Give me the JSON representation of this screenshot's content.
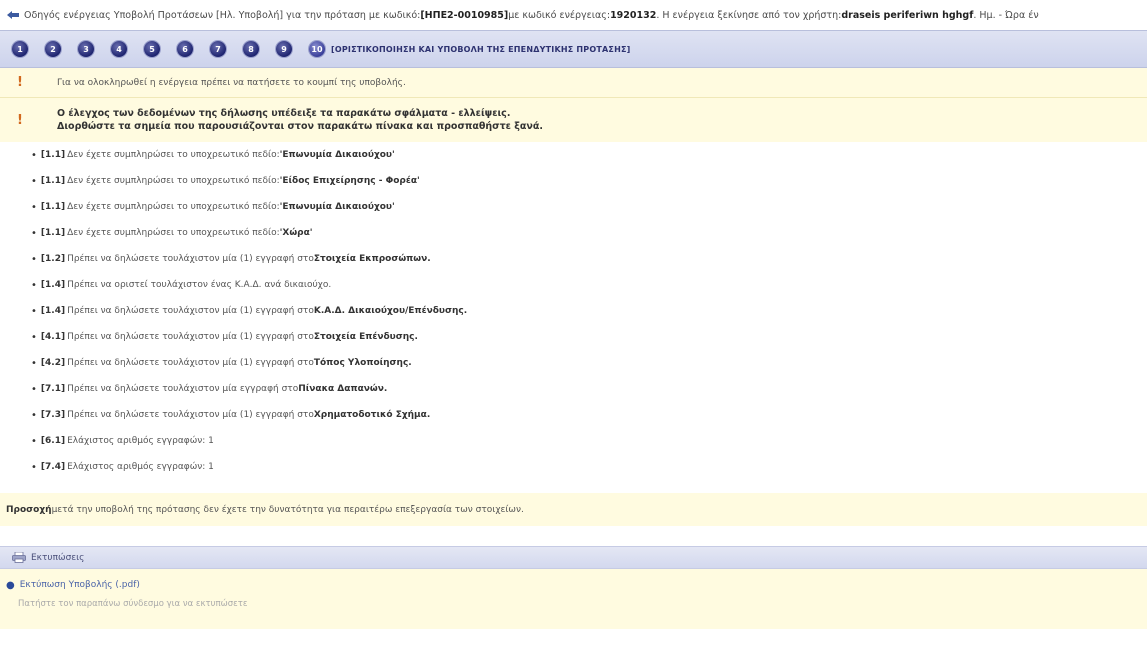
{
  "topbar": {
    "text_a": "Οδηγός ενέργειας Υποβολή Προτάσεων [Ηλ. Υποβολή] για την πρόταση με κωδικό: ",
    "proposal_code": "[ΗΠΕ2-0010985]",
    "text_b": " με κωδικό ενέργειας: ",
    "action_code": "1920132",
    "text_c": " . Η ενέργεια ξεκίνησε από τον χρήστη: ",
    "user": "draseis periferiwn hghgf",
    "text_d": " . Ημ. - Ώρα έν"
  },
  "steps": {
    "items": [
      "1",
      "2",
      "3",
      "4",
      "5",
      "6",
      "7",
      "8",
      "9"
    ],
    "active": "10",
    "active_title": "[ΟΡΙΣΤΙΚΟΠΟΙΗΣΗ ΚΑΙ ΥΠΟΒΟΛΗ ΤΗΣ ΕΠΕΝΔΥΤΙΚΗΣ ΠΡΟΤΑΣΗΣ]"
  },
  "warnings": {
    "w1": "Για να ολοκληρωθεί η ενέργεια πρέπει να πατήσετε το κουμπί της υποβολής.",
    "w2_line1": "Ο έλεγχος των δεδομένων της δήλωσης υπέδειξε τα παρακάτω σφάλματα - ελλείψεις.",
    "w2_line2": "Διορθώστε τα σημεία που παρουσιάζονται στον παρακάτω πίνακα και προσπαθήστε ξανά."
  },
  "errors": [
    {
      "code": "[1.1]",
      "text": "Δεν έχετε συμπληρώσει το υποχρεωτικό πεδίο: ",
      "bold": "'Επωνυμία Δικαιούχου'"
    },
    {
      "code": "[1.1]",
      "text": "Δεν έχετε συμπληρώσει το υποχρεωτικό πεδίο: ",
      "bold": "'Είδος Επιχείρησης - Φορέα'"
    },
    {
      "code": "[1.1]",
      "text": "Δεν έχετε συμπληρώσει το υποχρεωτικό πεδίο: ",
      "bold": "'Επωνυμία Δικαιούχου'"
    },
    {
      "code": "[1.1]",
      "text": "Δεν έχετε συμπληρώσει το υποχρεωτικό πεδίο: ",
      "bold": "'Χώρα'"
    },
    {
      "code": "[1.2]",
      "text": "Πρέπει να δηλώσετε τουλάχιστον μία (1) εγγραφή στο ",
      "bold": "Στοιχεία Εκπροσώπων."
    },
    {
      "code": "[1.4]",
      "text": "Πρέπει να οριστεί τουλάχιστον ένας Κ.Α.Δ. ανά δικαιούχο.",
      "bold": ""
    },
    {
      "code": "[1.4]",
      "text": "Πρέπει να δηλώσετε τουλάχιστον μία (1) εγγραφή στο ",
      "bold": "Κ.Α.Δ. Δικαιούχου/Επένδυσης."
    },
    {
      "code": "[4.1]",
      "text": "Πρέπει να δηλώσετε τουλάχιστον μία (1) εγγραφή στο ",
      "bold": "Στοιχεία Επένδυσης."
    },
    {
      "code": "[4.2]",
      "text": "Πρέπει να δηλώσετε τουλάχιστον μία (1) εγγραφή στο ",
      "bold": "Τόπος Υλοποίησης."
    },
    {
      "code": "[7.1]",
      "text": "Πρέπει να δηλώσετε τουλάχιστον μία εγγραφή στο ",
      "bold": "Πίνακα Δαπανών."
    },
    {
      "code": "[7.3]",
      "text": "Πρέπει να δηλώσετε τουλάχιστον μία (1) εγγραφή στο ",
      "bold": "Χρηματοδοτικό Σχήμα."
    },
    {
      "code": "[6.1]",
      "text": "Ελάχιστος αριθμός εγγραφών: 1",
      "bold": ""
    },
    {
      "code": "[7.4]",
      "text": "Ελάχιστος αριθμός εγγραφών: 1",
      "bold": ""
    }
  ],
  "notice": {
    "bold": "Προσοχή",
    "text": " μετά την υποβολή της πρότασης δεν έχετε την δυνατότητα για περαιτέρω επεξεργασία των στοιχείων."
  },
  "print": {
    "header": "Εκτυπώσεις",
    "link": "Εκτύπωση Υποβολής (.pdf)",
    "hint": "Πατήστε τον παραπάνω σύνδεσμο για να εκτυπώσετε"
  },
  "colors": {
    "warning_bg": "#fffbe0",
    "step_bar_bg": "#cdd3ec",
    "step_circle": "#1e2470",
    "link": "#4a63a8"
  }
}
